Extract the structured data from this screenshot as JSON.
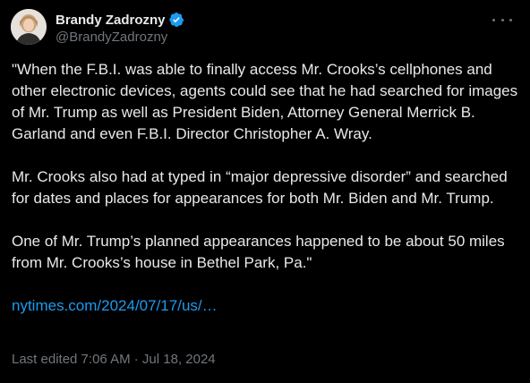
{
  "author": {
    "display_name": "Brandy Zadrozny",
    "handle": "@BrandyZadrozny",
    "verified": true
  },
  "icons": {
    "verified": "verified-badge-icon",
    "more": "more-horizontal-icon"
  },
  "tweet": {
    "paragraphs": [
      "\"When the F.B.I. was able to finally access Mr. Crooks’s cellphones and other electronic devices, agents could see that he had searched for images of Mr. Trump as well as President Biden, Attorney General Merrick B. Garland and even F.B.I. Director Christopher A. Wray.",
      "Mr. Crooks also had at typed in “major depressive disorder” and searched for dates and places for appearances for both Mr. Biden and Mr. Trump.",
      "One of Mr. Trump’s planned appearances happened to be about 50 miles from Mr. Crooks’s house in Bethel Park, Pa.\""
    ],
    "link": "nytimes.com/2024/07/17/us/…",
    "meta": "Last edited 7:06 AM · Jul 18, 2024"
  },
  "colors": {
    "background": "#000000",
    "text": "#e7e9ea",
    "secondary": "#71767b",
    "link": "#1d9bf0"
  }
}
